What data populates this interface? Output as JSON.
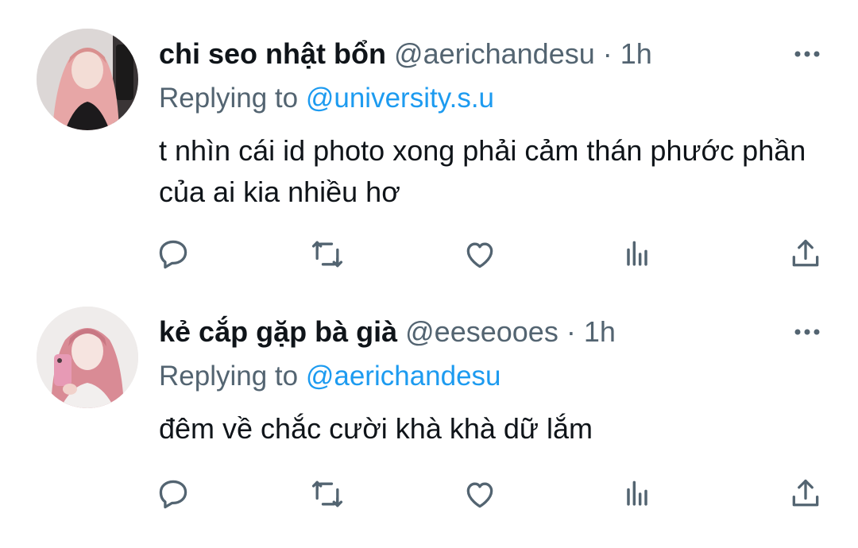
{
  "tweets": [
    {
      "display_name": "chi seo nhật bổn",
      "handle": "@aerichandesu",
      "separator": "·",
      "time": "1h",
      "replying_prefix": "Replying to",
      "replying_to": "@university.s.u",
      "text": "t nhìn cái id photo xong phải cảm thán phước phần của ai kia nhiều hơ",
      "avatar_colors": {
        "hair": "#e7a6a6",
        "bg": "#dcd7d6",
        "clothes": "#1c1a1c"
      }
    },
    {
      "display_name": "kẻ cắp gặp bà già",
      "handle": "@eeseooes",
      "separator": "·",
      "time": "1h",
      "replying_prefix": "Replying to",
      "replying_to": "@aerichandesu",
      "text": "đêm về chắc cười khà khà dữ lắm",
      "avatar_colors": {
        "hair": "#d98b95",
        "bg": "#efeceb",
        "phone": "#e79ab5"
      }
    }
  ],
  "icons": {
    "more": "more-horizontal-icon",
    "reply": "speech-bubble-icon",
    "retweet": "retweet-arrows-icon",
    "like": "heart-outline-icon",
    "views": "bar-chart-icon",
    "share": "upload-share-icon"
  },
  "colors": {
    "text_primary": "#0f1419",
    "text_secondary": "#536471",
    "link": "#1d9bf0",
    "icon": "#536471"
  }
}
